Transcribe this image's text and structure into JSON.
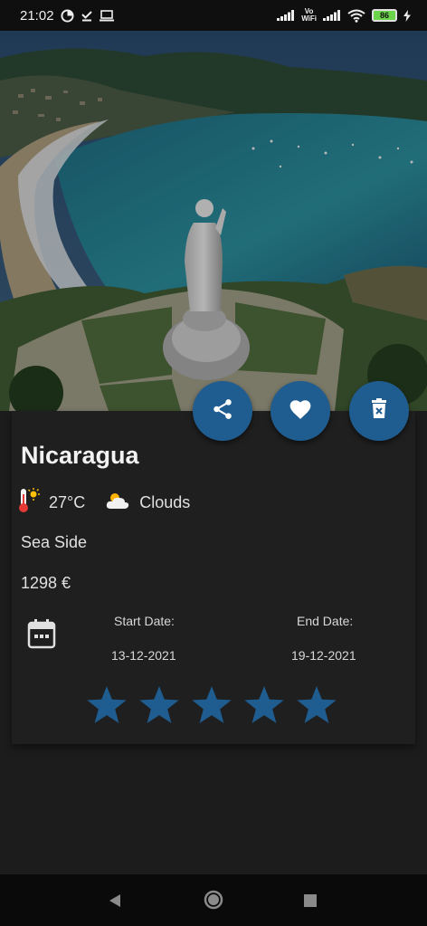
{
  "status_bar": {
    "time": "21:02",
    "vo_wifi_top": "Vo",
    "vo_wifi_bottom": "WiFi",
    "battery": "86"
  },
  "hero": {
    "image_alt": "Coastal bay with statue"
  },
  "actions": {
    "share_icon": "share-icon",
    "favorite_icon": "heart-icon",
    "delete_icon": "delete-icon"
  },
  "trip": {
    "destination": "Nicaragua",
    "temperature": "27°C",
    "weather": "Clouds",
    "category": "Sea Side",
    "price": "1298 €",
    "start_label": "Start Date:",
    "start_date": "13-12-2021",
    "end_label": "End Date:",
    "end_date": "19-12-2021",
    "rating": 5,
    "rating_max": 5
  },
  "colors": {
    "accent": "#1f5d91",
    "background": "#1c1c1c",
    "card": "#1f1f1f"
  }
}
